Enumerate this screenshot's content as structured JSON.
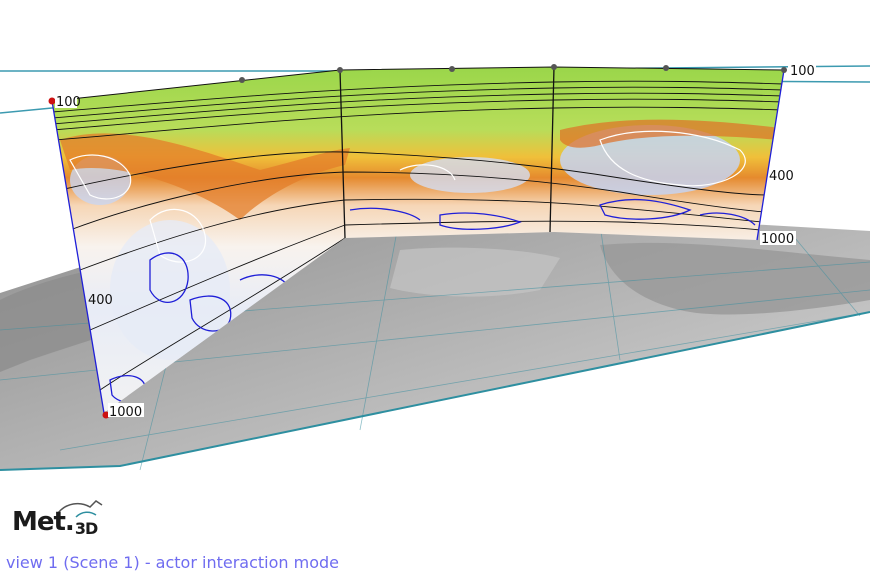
{
  "window": {
    "status_text": "view 1 (Scene 1) - actor interaction mode"
  },
  "logo": {
    "name": "Met.",
    "suffix": "3D"
  },
  "section": {
    "left_ticks": {
      "top": "100",
      "mid": "400",
      "bottom": "1000"
    },
    "right_ticks": {
      "top": "100",
      "mid": "400",
      "bottom": "1000"
    }
  },
  "colors": {
    "background": "#ffffff",
    "map_land": "#9a9a9a",
    "map_sea": "#cfcfcf",
    "grid_lines": "#3a8fa0",
    "stratosphere_green": "#9ad64a",
    "tropopause_orange": "#e58a2e",
    "contour_blue": "#1f1fd8",
    "contour_white": "#ffffff",
    "handle_red": "#cc1111",
    "status_text": "#6f6cf0"
  },
  "icons": [
    "met3d-logo-icon",
    "waypoint-handle-icon"
  ]
}
